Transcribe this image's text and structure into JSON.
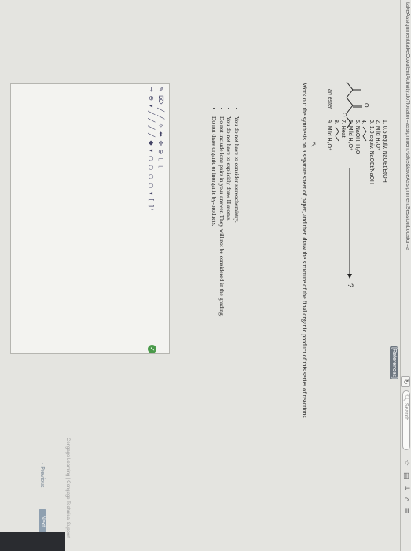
{
  "browser": {
    "url": "takeAssignment/takeCovalentActivity.do?locator=assignment-take&takeAssignmentSessionLocator=a",
    "reload_icon": "reload-icon",
    "search_placeholder": "Search",
    "toolbar_icons": [
      "star-icon",
      "reading-list-icon",
      "download-icon",
      "home-icon",
      "menu-icon"
    ]
  },
  "page": {
    "references_label": "[References]",
    "reagents": [
      "1. 0.5 equiv. NaOEt/EtOH",
      "2. Mild H₃O⁺",
      "3. 1.0 equiv. NaOEt/NaOH",
      "4.",
      "5. NaOH, H₂O",
      "6. Mild H₃O⁺",
      "7. Heat",
      "8.",
      "9. Mild H₃O⁺"
    ],
    "product_mark": "?",
    "ester_label": "an ester",
    "instruction": "Work out the synthesis on a separate sheet of paper, and then draw the structure of the final organic product of this series of reactions.",
    "bullets": [
      "You do not have to consider stereochemistry.",
      "You do not have to explicitly draw H atoms.",
      "Do not include lone pairs in your answer. They will not be considered in the grading.",
      "Do not draw organic or inorganic by-products."
    ],
    "editor": {
      "toolbar_row1": "✎ ⌦ ╱ ╱ ✧ ⬌  ✛ ⊖  ⌷ ⌷",
      "toolbar_row2": "→ ⊕ ▾  ╱ ╱ ╱ ╱ ◆ ▾ ○ ○ ○ ○ ▾  [ ]⁺",
      "check_glyph": "✓"
    },
    "footer_text": "Cengage Learning | Cengage Technical Support",
    "previous_label": "‹ Previous",
    "next_label": "Next"
  }
}
